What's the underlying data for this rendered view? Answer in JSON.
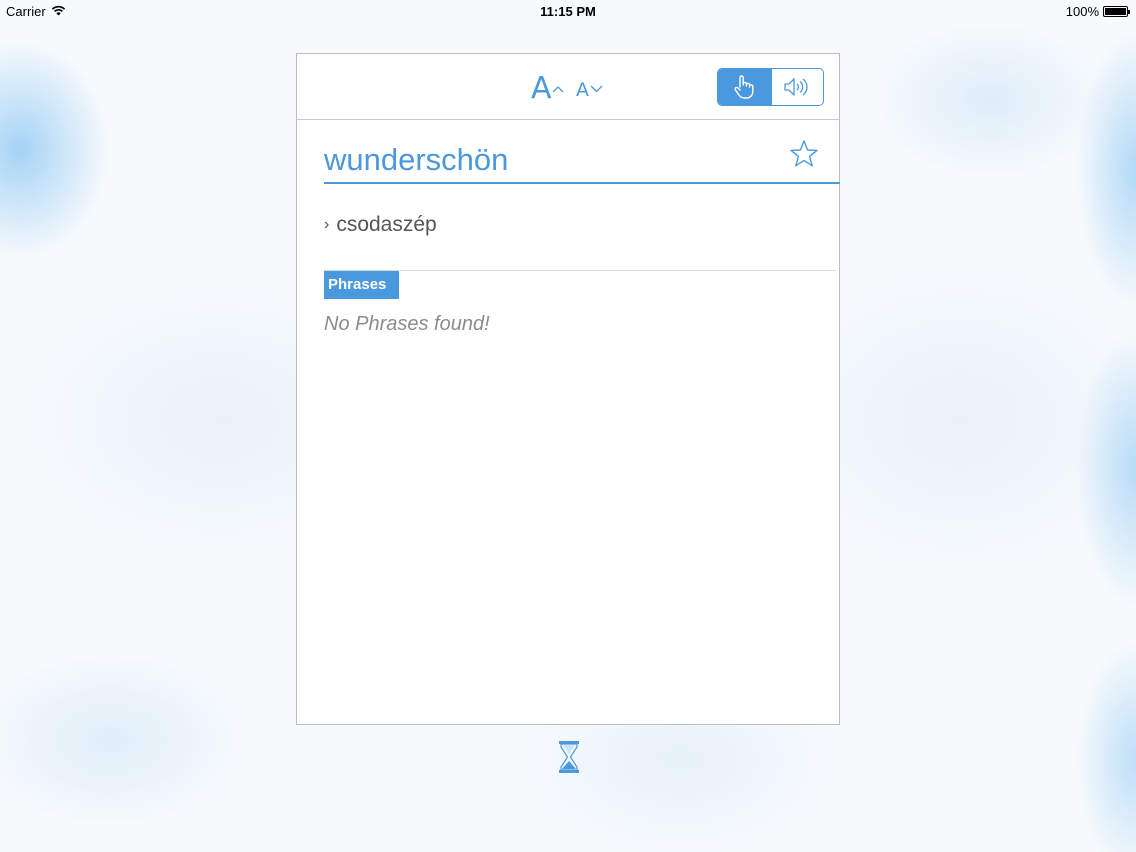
{
  "status_bar": {
    "carrier": "Carrier",
    "time": "11:15 PM",
    "battery": "100%"
  },
  "toolbar": {
    "font_increase_label": "A",
    "font_decrease_label": "A",
    "mode_touch_icon": "hand-pointer-icon",
    "mode_audio_icon": "speaker-icon",
    "active_mode": "touch"
  },
  "entry": {
    "word": "wunderschön",
    "favorite_icon": "star-outline-icon",
    "translation": "csodaszép",
    "translation_marker": "›"
  },
  "phrases": {
    "heading": "Phrases",
    "empty_message": "No Phrases found!"
  },
  "footer": {
    "loading_icon": "hourglass-icon"
  },
  "colors": {
    "accent": "#4a98de",
    "text_muted": "#8c8c8c",
    "text_secondary": "#555555"
  }
}
